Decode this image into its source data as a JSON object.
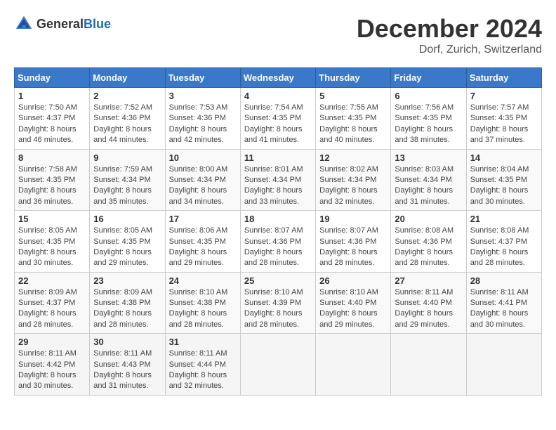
{
  "header": {
    "logo_general": "General",
    "logo_blue": "Blue",
    "month_year": "December 2024",
    "location": "Dorf, Zurich, Switzerland"
  },
  "weekdays": [
    "Sunday",
    "Monday",
    "Tuesday",
    "Wednesday",
    "Thursday",
    "Friday",
    "Saturday"
  ],
  "weeks": [
    [
      {
        "day": "1",
        "sunrise": "7:50 AM",
        "sunset": "4:37 PM",
        "daylight": "8 hours and 46 minutes."
      },
      {
        "day": "2",
        "sunrise": "7:52 AM",
        "sunset": "4:36 PM",
        "daylight": "8 hours and 44 minutes."
      },
      {
        "day": "3",
        "sunrise": "7:53 AM",
        "sunset": "4:36 PM",
        "daylight": "8 hours and 42 minutes."
      },
      {
        "day": "4",
        "sunrise": "7:54 AM",
        "sunset": "4:35 PM",
        "daylight": "8 hours and 41 minutes."
      },
      {
        "day": "5",
        "sunrise": "7:55 AM",
        "sunset": "4:35 PM",
        "daylight": "8 hours and 40 minutes."
      },
      {
        "day": "6",
        "sunrise": "7:56 AM",
        "sunset": "4:35 PM",
        "daylight": "8 hours and 38 minutes."
      },
      {
        "day": "7",
        "sunrise": "7:57 AM",
        "sunset": "4:35 PM",
        "daylight": "8 hours and 37 minutes."
      }
    ],
    [
      {
        "day": "8",
        "sunrise": "7:58 AM",
        "sunset": "4:35 PM",
        "daylight": "8 hours and 36 minutes."
      },
      {
        "day": "9",
        "sunrise": "7:59 AM",
        "sunset": "4:34 PM",
        "daylight": "8 hours and 35 minutes."
      },
      {
        "day": "10",
        "sunrise": "8:00 AM",
        "sunset": "4:34 PM",
        "daylight": "8 hours and 34 minutes."
      },
      {
        "day": "11",
        "sunrise": "8:01 AM",
        "sunset": "4:34 PM",
        "daylight": "8 hours and 33 minutes."
      },
      {
        "day": "12",
        "sunrise": "8:02 AM",
        "sunset": "4:34 PM",
        "daylight": "8 hours and 32 minutes."
      },
      {
        "day": "13",
        "sunrise": "8:03 AM",
        "sunset": "4:34 PM",
        "daylight": "8 hours and 31 minutes."
      },
      {
        "day": "14",
        "sunrise": "8:04 AM",
        "sunset": "4:35 PM",
        "daylight": "8 hours and 30 minutes."
      }
    ],
    [
      {
        "day": "15",
        "sunrise": "8:05 AM",
        "sunset": "4:35 PM",
        "daylight": "8 hours and 30 minutes."
      },
      {
        "day": "16",
        "sunrise": "8:05 AM",
        "sunset": "4:35 PM",
        "daylight": "8 hours and 29 minutes."
      },
      {
        "day": "17",
        "sunrise": "8:06 AM",
        "sunset": "4:35 PM",
        "daylight": "8 hours and 29 minutes."
      },
      {
        "day": "18",
        "sunrise": "8:07 AM",
        "sunset": "4:36 PM",
        "daylight": "8 hours and 28 minutes."
      },
      {
        "day": "19",
        "sunrise": "8:07 AM",
        "sunset": "4:36 PM",
        "daylight": "8 hours and 28 minutes."
      },
      {
        "day": "20",
        "sunrise": "8:08 AM",
        "sunset": "4:36 PM",
        "daylight": "8 hours and 28 minutes."
      },
      {
        "day": "21",
        "sunrise": "8:08 AM",
        "sunset": "4:37 PM",
        "daylight": "8 hours and 28 minutes."
      }
    ],
    [
      {
        "day": "22",
        "sunrise": "8:09 AM",
        "sunset": "4:37 PM",
        "daylight": "8 hours and 28 minutes."
      },
      {
        "day": "23",
        "sunrise": "8:09 AM",
        "sunset": "4:38 PM",
        "daylight": "8 hours and 28 minutes."
      },
      {
        "day": "24",
        "sunrise": "8:10 AM",
        "sunset": "4:38 PM",
        "daylight": "8 hours and 28 minutes."
      },
      {
        "day": "25",
        "sunrise": "8:10 AM",
        "sunset": "4:39 PM",
        "daylight": "8 hours and 28 minutes."
      },
      {
        "day": "26",
        "sunrise": "8:10 AM",
        "sunset": "4:40 PM",
        "daylight": "8 hours and 29 minutes."
      },
      {
        "day": "27",
        "sunrise": "8:11 AM",
        "sunset": "4:40 PM",
        "daylight": "8 hours and 29 minutes."
      },
      {
        "day": "28",
        "sunrise": "8:11 AM",
        "sunset": "4:41 PM",
        "daylight": "8 hours and 30 minutes."
      }
    ],
    [
      {
        "day": "29",
        "sunrise": "8:11 AM",
        "sunset": "4:42 PM",
        "daylight": "8 hours and 30 minutes."
      },
      {
        "day": "30",
        "sunrise": "8:11 AM",
        "sunset": "4:43 PM",
        "daylight": "8 hours and 31 minutes."
      },
      {
        "day": "31",
        "sunrise": "8:11 AM",
        "sunset": "4:44 PM",
        "daylight": "8 hours and 32 minutes."
      },
      null,
      null,
      null,
      null
    ]
  ],
  "labels": {
    "sunrise": "Sunrise:",
    "sunset": "Sunset:",
    "daylight": "Daylight:"
  }
}
